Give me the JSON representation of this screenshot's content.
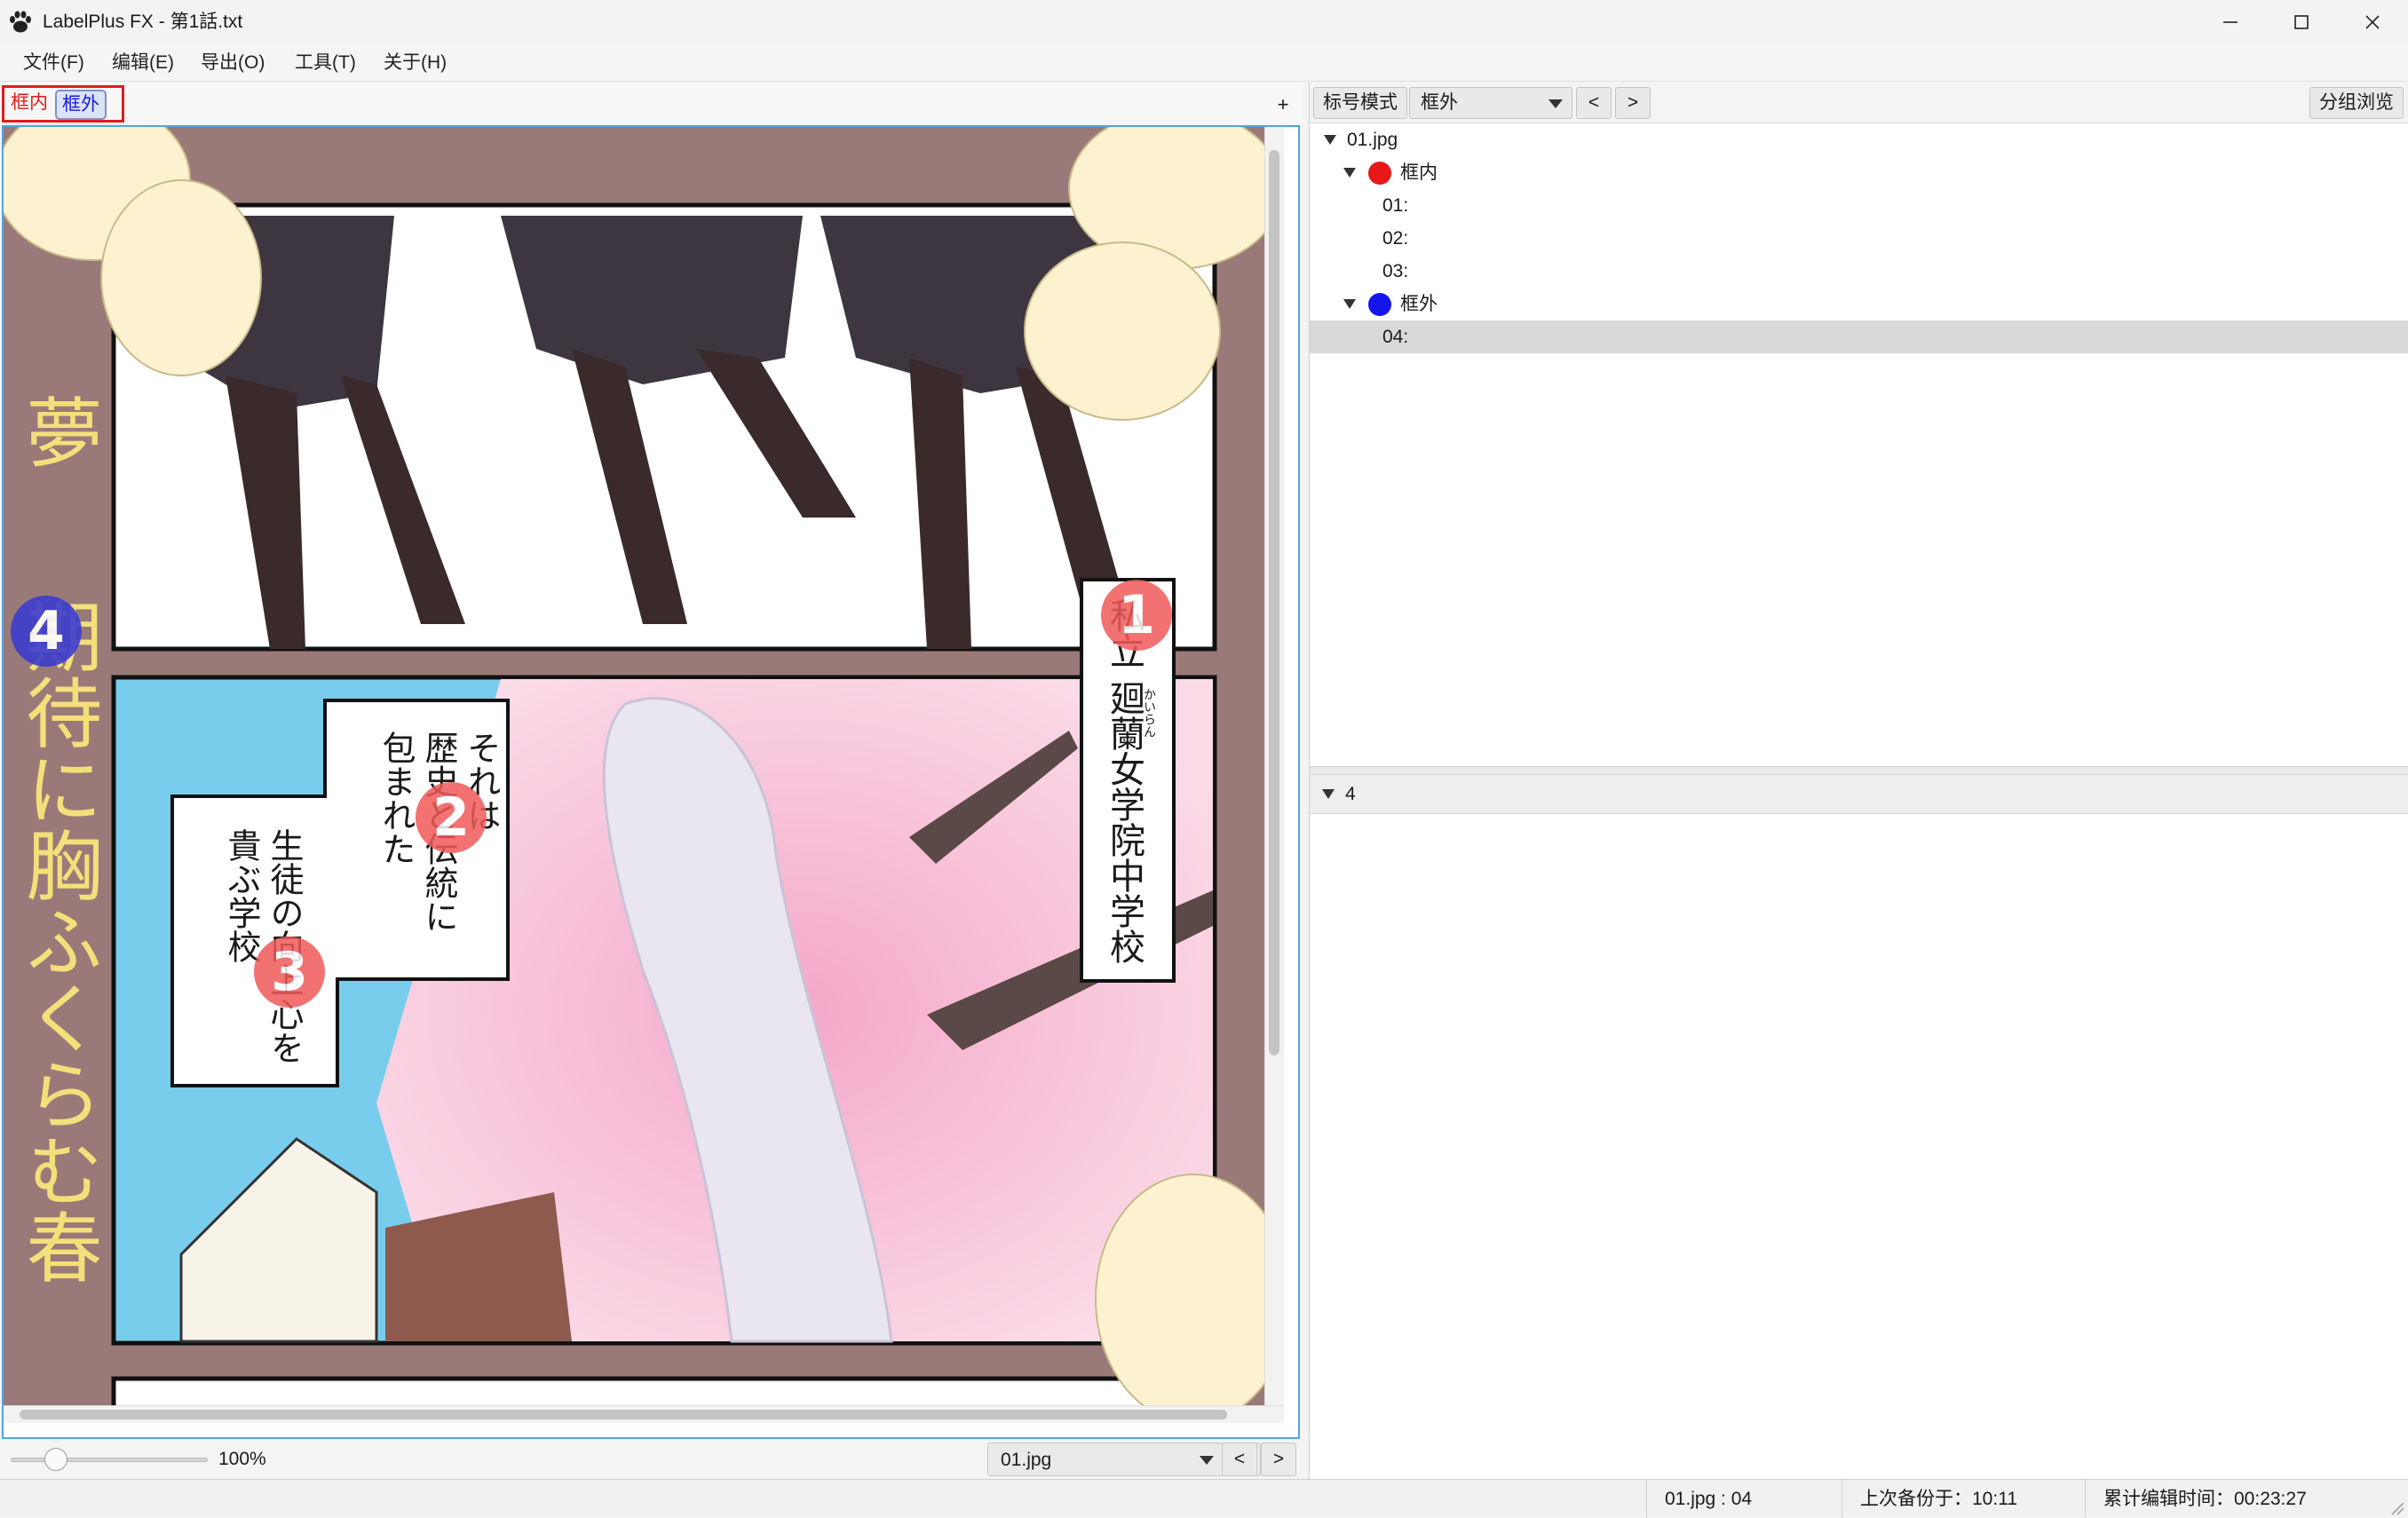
{
  "window": {
    "title": "LabelPlus FX - 第1話.txt",
    "icon": "paw-icon",
    "controls": [
      "minimize-icon",
      "maximize-icon",
      "close-icon"
    ]
  },
  "menu": [
    "文件(F)",
    "编辑(E)",
    "导出(O)",
    "工具(T)",
    "关于(H)"
  ],
  "groups": {
    "inside": {
      "label": "框内",
      "color": "#e01b1b"
    },
    "outside": {
      "label": "框外",
      "color": "#1a1ae0"
    },
    "add_label": "+"
  },
  "canvas": {
    "page_text": {
      "side_title_top": "夢",
      "side_title_bottom": "期待に胸ふくらむ春",
      "school_caption": "私立 廻蘭女学院中学校",
      "furigana": "かいらん",
      "caption2": [
        "それは",
        "歴史と伝統に",
        "包まれた"
      ],
      "caption3": [
        "生徒の向上心を",
        "貴ぶ学校"
      ]
    },
    "markers": [
      {
        "num": "1",
        "color": "#f05a5a"
      },
      {
        "num": "2",
        "color": "#f05a5a"
      },
      {
        "num": "3",
        "color": "#f05a5a"
      },
      {
        "num": "4",
        "color": "#3c3ccf"
      }
    ]
  },
  "zoom": {
    "label": "100%",
    "value_percent": 100
  },
  "file_nav": {
    "selected": "01.jpg",
    "prev": "<",
    "next": ">"
  },
  "right_toolbar": {
    "mode_label": "标号模式",
    "group_select": "框外",
    "prev": "<",
    "next": ">",
    "group_browse": "分组浏览"
  },
  "tree": {
    "file": "01.jpg",
    "groups": [
      {
        "name": "框内",
        "color": "#e81818",
        "labels": [
          "01:",
          "02:",
          "03:"
        ]
      },
      {
        "name": "框外",
        "color": "#1515ee",
        "labels": [
          "04:"
        ]
      }
    ],
    "selected": "04:"
  },
  "editor": {
    "header": "4",
    "text": ""
  },
  "status": {
    "position": "01.jpg : 04",
    "backup": "上次备份于：10:11",
    "edit_time": "累计编辑时间：00:23:27"
  }
}
